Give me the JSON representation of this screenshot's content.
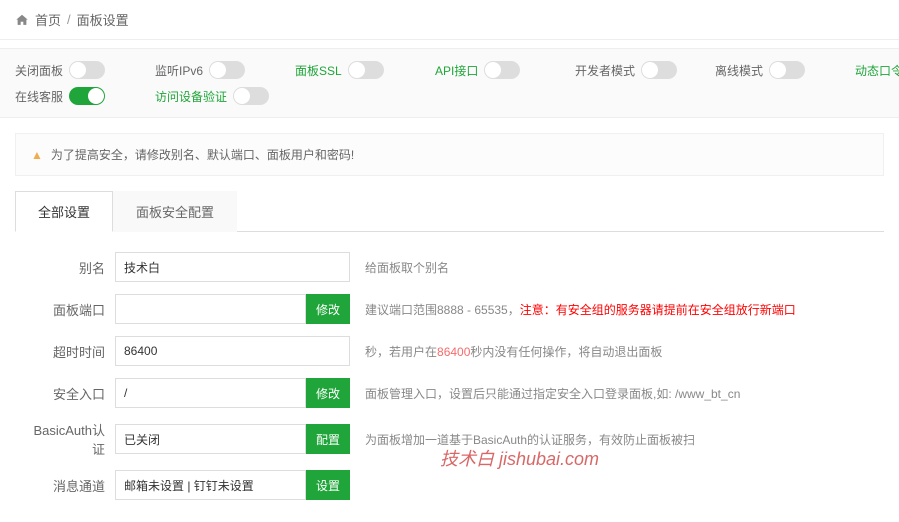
{
  "breadcrumb": {
    "home": "首页",
    "current": "面板设置"
  },
  "toggles": {
    "row1": [
      {
        "label": "关闭面板",
        "on": false,
        "green": false
      },
      {
        "label": "监听IPv6",
        "on": false,
        "green": false
      },
      {
        "label": "面板SSL",
        "on": false,
        "green": true
      },
      {
        "label": "API接口",
        "on": false,
        "green": true
      },
      {
        "label": "开发者模式",
        "on": false,
        "green": false
      },
      {
        "label": "离线模式",
        "on": false,
        "green": false
      },
      {
        "label": "动态口令认证",
        "on": false,
        "green": true
      }
    ],
    "row2": [
      {
        "label": "在线客服",
        "on": true,
        "green": false
      },
      {
        "label": "访问设备验证",
        "on": false,
        "green": true
      }
    ]
  },
  "warning": "为了提高安全，请修改别名、默认端口、面板用户和密码!",
  "tabs": [
    {
      "label": "全部设置",
      "active": true
    },
    {
      "label": "面板安全配置",
      "active": false
    }
  ],
  "form": {
    "alias": {
      "label": "别名",
      "value": "技术白",
      "tip": "给面板取个别名"
    },
    "port": {
      "label": "面板端口",
      "value": "",
      "btn": "修改",
      "tip_prefix": "建议端口范围8888 - 65535，",
      "tip_red": "注意：有安全组的服务器请提前在安全组放行新端口"
    },
    "timeout": {
      "label": "超时时间",
      "value": "86400",
      "tip_prefix": "秒，若用户在",
      "tip_num": "86400",
      "tip_suffix": "秒内没有任何操作，将自动退出面板"
    },
    "entry": {
      "label": "安全入口",
      "value": "/",
      "btn": "修改",
      "tip": "面板管理入口，设置后只能通过指定安全入口登录面板,如: /www_bt_cn"
    },
    "basicauth": {
      "label": "BasicAuth认证",
      "value": "已关闭",
      "btn": "配置",
      "tip": "为面板增加一道基于BasicAuth的认证服务，有效防止面板被扫"
    },
    "msgchannel": {
      "label": "消息通道",
      "value": "邮箱未设置 | 钉钉未设置",
      "btn": "设置"
    }
  },
  "watermark": "技术白 jishubai.com"
}
